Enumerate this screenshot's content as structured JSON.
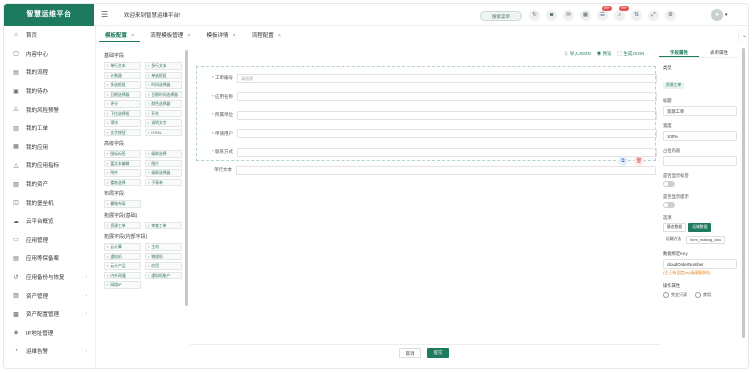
{
  "app": {
    "logo": "智慧运维平台",
    "welcome": "欢迎来到智慧运维平台!"
  },
  "header": {
    "search": "搜索菜单",
    "icons": [
      "refresh-icon",
      "message-icon",
      "mail-icon",
      "calendar-icon",
      "notify-icon",
      "bell-icon",
      "stock-icon",
      "fullscreen-icon",
      "settings-icon"
    ],
    "notify_badge": "99+",
    "bell_badge": "99+",
    "user": "▾"
  },
  "sidebar": {
    "items": [
      {
        "label": "首页",
        "icon": "⌂",
        "name": "home"
      },
      {
        "label": "内容中心",
        "icon": "▢",
        "name": "content-center"
      },
      {
        "label": "我的流程",
        "icon": "▤",
        "name": "my-process"
      },
      {
        "label": "我的待办",
        "icon": "▣",
        "name": "my-todo"
      },
      {
        "label": "我的风险预警",
        "icon": "⚠",
        "name": "my-risk"
      },
      {
        "label": "我的工单",
        "icon": "▥",
        "name": "my-ticket"
      },
      {
        "label": "我的应用",
        "icon": "▦",
        "name": "my-app"
      },
      {
        "label": "我的应用指标",
        "icon": "△",
        "name": "my-app-metrics"
      },
      {
        "label": "我的资产",
        "icon": "▧",
        "name": "my-assets"
      },
      {
        "label": "我的堡垒机",
        "icon": "◫",
        "name": "my-bastion"
      },
      {
        "label": "云平台概览",
        "icon": "☁",
        "name": "cloud-overview"
      },
      {
        "label": "应用管理",
        "icon": "▭",
        "name": "app-manage"
      },
      {
        "label": "应用等保备案",
        "icon": "▤",
        "name": "app-filing"
      },
      {
        "label": "应用备份与恢复",
        "icon": "↺",
        "name": "backup-restore",
        "arrow": "›"
      },
      {
        "label": "资产管理",
        "icon": "▨",
        "name": "asset-manage",
        "arrow": "›"
      },
      {
        "label": "资产配置管理",
        "icon": "▩",
        "name": "asset-config",
        "arrow": "›"
      },
      {
        "label": "IP地址管理",
        "icon": "◈",
        "name": "ip-manage"
      },
      {
        "label": "运维告警",
        "icon": "◔",
        "name": "ops-alert",
        "arrow": "›"
      }
    ]
  },
  "tabs": [
    {
      "label": "模板配置",
      "active": true
    },
    {
      "label": "流程模板管理"
    },
    {
      "label": "模板详情"
    },
    {
      "label": "流程配置"
    }
  ],
  "tab_close": "×",
  "palette": {
    "groups": [
      {
        "title": "基础字段",
        "items": [
          "单行文本",
          "多行文本",
          "计数器",
          "单选框组",
          "多选框组",
          "时间选择器",
          "日期选择器",
          "日期时间选择器",
          "评分",
          "颜色选择器",
          "下拉选择框",
          "开关",
          "滑块",
          "说明文字",
          "文字按钮",
          "HTML"
        ]
      },
      {
        "title": "高级字段",
        "items": [
          "图标标签",
          "级联选择",
          "富文本编辑",
          "图片",
          "附件",
          "级联选择器",
          "楼栋选择",
          "子表单"
        ]
      },
      {
        "title": "布局字段",
        "items": [
          "栅格布局"
        ]
      },
      {
        "title": "拓展字段(基础)",
        "items": [
          "资源工单",
          "审查工单"
        ]
      },
      {
        "title": "拓展字段(内部字段)",
        "items": [
          "云计算",
          "主机",
          "虚拟机",
          "物理机",
          "云计产品",
          "应用",
          "内外网通",
          "虚拟机账户",
          "网络IP"
        ]
      }
    ]
  },
  "toolbar": {
    "import": "导入JSON",
    "preview": "预览",
    "generate": "生成JSON"
  },
  "form": {
    "fields": [
      {
        "label": "工单编号",
        "required": true,
        "placeholder": "请选择",
        "selected": true
      },
      {
        "label": "应用名称",
        "required": true,
        "placeholder": ""
      },
      {
        "label": "所属单位",
        "required": true,
        "placeholder": ""
      },
      {
        "label": "申请用户",
        "required": true,
        "placeholder": ""
      },
      {
        "label": "联系方式",
        "required": true,
        "placeholder": ""
      }
    ],
    "extra_field": "单行文本"
  },
  "props": {
    "tabs": [
      "字段属性",
      "表单属性"
    ],
    "type_label": "类型",
    "type_value": "资源工单",
    "title_label": "标题",
    "title_value": "资源工单",
    "width_label": "宽度",
    "width_value": "100%",
    "placeholder_label": "占位内容",
    "show_label": "是否显示标签",
    "show_placeholder": "是否显示提示",
    "options_label": "选项",
    "options_tabs": [
      "静态数据",
      "远端数据"
    ],
    "remote_method": "远端方法",
    "remote_value": "form_making_clou",
    "key_label": "数据绑定Key",
    "key_value": "cloudOrderNumber",
    "key_hint": "(注:已有固定key请谨慎修改)",
    "op_label": "操作属性",
    "op_options": [
      "完全只读",
      "禁用"
    ]
  },
  "actions": {
    "cancel": "取消",
    "submit": "提交"
  },
  "colors": {
    "brand": "#1e7a5f",
    "danger": "#e55353"
  }
}
